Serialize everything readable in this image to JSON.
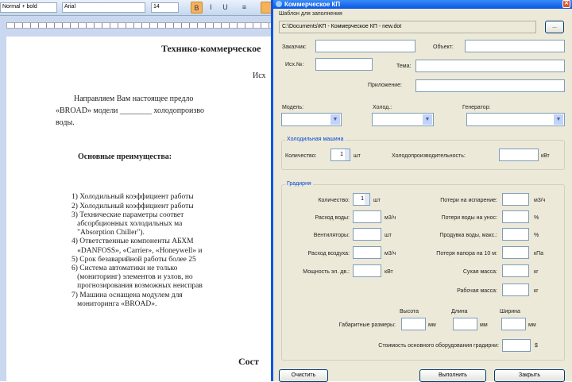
{
  "word": {
    "style_box": "Normal + bold",
    "font_box": "Arial",
    "size_box": "14",
    "toolbar_buttons": [
      "B",
      "I",
      "U",
      "≡"
    ],
    "doc": {
      "title": "Технико-коммерческое",
      "ref": "Исх",
      "para": [
        "Направляем Вам настоящее предло",
        "«BROAD» модели ________ холодопроизво",
        "воды."
      ],
      "heading": "Основные преимущества:",
      "list": [
        "1) Холодильный коэффициент работы ",
        "2) Холодильный коэффициент работы ",
        "3) Технические параметры соответ",
        "   абсорбционных холодильных ма",
        "   \"Absorption Chiller\").",
        "4) Ответственные компоненты АБХМ ",
        "   «DANFOSS», «Carrier», «Honeywell» и",
        "5) Срок безаварийной работы более 25",
        "6) Система автоматики не только ",
        "   (мониторинг) элементов и узлов, но ",
        "   прогнозирования возможных неисправ",
        "7) Машина оснащена модулем для ",
        "   мониторинга «BROAD»."
      ],
      "footer_heading": "Сост"
    }
  },
  "dialog": {
    "title": "Коммерческое КП",
    "template_label": "Шаблон для заполнения",
    "template_path": "C:\\Documents\\КП - Коммерческое КП - new.dot",
    "browse_label": "...",
    "customer_label": "Заказчик:",
    "object_label": "Объект:",
    "ref_label": "Исх.№:",
    "subject_label": "Тема:",
    "attachment_label": "Приложение:",
    "model_label": "Модель:",
    "cooling_label": "Холод.:",
    "generator_label": "Генератор:",
    "chiller": {
      "title": "Холодильная машина",
      "qty_label": "Количество:",
      "qty_value": "1",
      "qty_unit": "шт",
      "capacity_label": "Холодопроизводительность:",
      "capacity_unit": "кВт"
    },
    "tower": {
      "title": "Градирня",
      "left": [
        {
          "label": "Количество:",
          "unit": "шт",
          "value": "1"
        },
        {
          "label": "Расход воды:",
          "unit": "м3/ч",
          "value": ""
        },
        {
          "label": "Вентиляторы:",
          "unit": "шт",
          "value": ""
        },
        {
          "label": "Расход воздуха:",
          "unit": "м3/ч",
          "value": ""
        },
        {
          "label": "Мощность эл. дв.:",
          "unit": "кВт",
          "value": ""
        }
      ],
      "right": [
        {
          "label": "Потери на испарение:",
          "unit": "м3/ч"
        },
        {
          "label": "Потери воды на унос:",
          "unit": "%"
        },
        {
          "label": "Продувка воды, макс.:",
          "unit": "%"
        },
        {
          "label": "Потеря напора на 10 м:",
          "unit": "кПа"
        },
        {
          "label": "Сухая масса:",
          "unit": "кг"
        },
        {
          "label": "Рабочая масса:",
          "unit": "кг"
        }
      ],
      "dims_label": "Габаритные размеры:",
      "dims": [
        {
          "label": "Высота",
          "unit": "мм"
        },
        {
          "label": "Длина",
          "unit": "мм"
        },
        {
          "label": "Ширина",
          "unit": "мм"
        }
      ],
      "cost_label": "Стоимость основного оборудования градирни:",
      "cost_unit": "$"
    },
    "buttons": {
      "left": "Очистить",
      "ok": "Выполнить",
      "close": "Закрыть"
    }
  }
}
